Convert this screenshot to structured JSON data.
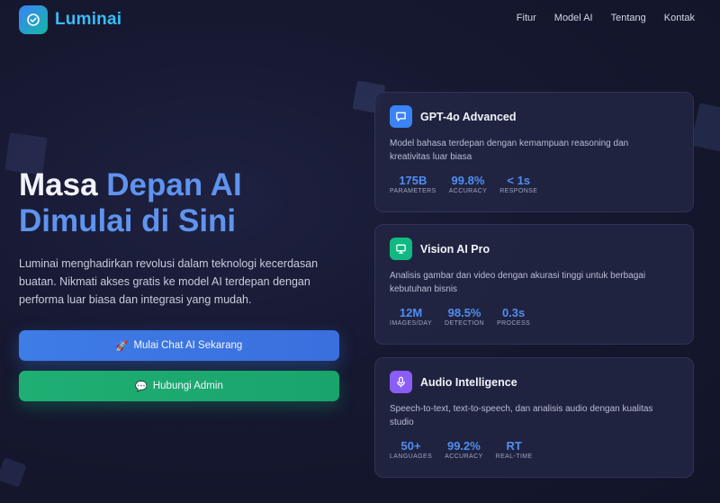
{
  "brand": {
    "name": "Luminai",
    "logo_icon": "check-badge-icon"
  },
  "nav": [
    "Fitur",
    "Model AI",
    "Tentang",
    "Kontak"
  ],
  "hero": {
    "title_line1_a": "Masa ",
    "title_line1_b": "Depan AI",
    "title_line2_a": "Dimulai",
    "title_line2_b": " di Sini",
    "description": "Luminai menghadirkan revolusi dalam teknologi kecerdasan buatan. Nikmati akses gratis ke model AI terdepan dengan performa luar biasa dan integrasi yang mudah."
  },
  "buttons": {
    "chat": {
      "icon": "🚀",
      "label": "Mulai Chat AI Sekarang"
    },
    "admin": {
      "icon": "💬",
      "label": "Hubungi Admin"
    }
  },
  "cards": [
    {
      "title": "GPT-4o Advanced",
      "icon": "chat-bubble-icon",
      "icon_color": "#3b82f6",
      "description": "Model bahasa terdepan dengan kemampuan reasoning dan kreativitas luar biasa",
      "stats": [
        {
          "value": "175B",
          "label": "PARAMETERS"
        },
        {
          "value": "99.8%",
          "label": "ACCURACY"
        },
        {
          "value": "< 1s",
          "label": "RESPONSE"
        }
      ]
    },
    {
      "title": "Vision AI Pro",
      "icon": "monitor-icon",
      "icon_color": "#10b981",
      "description": "Analisis gambar dan video dengan akurasi tinggi untuk berbagai kebutuhan bisnis",
      "stats": [
        {
          "value": "12M",
          "label": "IMAGES/DAY"
        },
        {
          "value": "98.5%",
          "label": "DETECTION"
        },
        {
          "value": "0.3s",
          "label": "PROCESS"
        }
      ]
    },
    {
      "title": "Audio Intelligence",
      "icon": "microphone-icon",
      "icon_color": "#8b5cf6",
      "description": "Speech-to-text, text-to-speech, dan analisis audio dengan kualitas studio",
      "stats": [
        {
          "value": "50+",
          "label": "LANGUAGES"
        },
        {
          "value": "99.2%",
          "label": "ACCURACY"
        },
        {
          "value": "RT",
          "label": "REAL-TIME"
        }
      ]
    }
  ]
}
